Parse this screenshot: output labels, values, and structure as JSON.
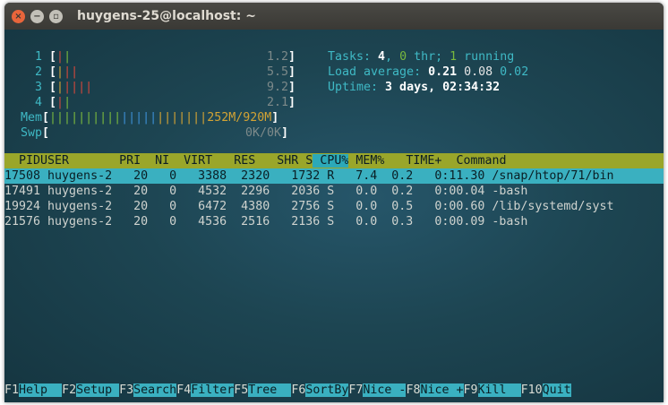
{
  "window": {
    "title": "huygens-25@localhost: ~"
  },
  "meters": {
    "cpus": [
      {
        "label": "1",
        "bars": [
          [
            "red",
            "|"
          ],
          [
            "green",
            "|"
          ]
        ],
        "value": "1.2"
      },
      {
        "label": "2",
        "bars": [
          [
            "yellow",
            "|"
          ],
          [
            "red",
            "|"
          ],
          [
            "red",
            "|"
          ]
        ],
        "value": "5.5"
      },
      {
        "label": "3",
        "bars": [
          [
            "yellow",
            "|"
          ],
          [
            "red",
            "|"
          ],
          [
            "red",
            "|"
          ],
          [
            "red",
            "|"
          ],
          [
            "red",
            "|"
          ]
        ],
        "value": "9.2"
      },
      {
        "label": "4",
        "bars": [
          [
            "red",
            "|"
          ],
          [
            "green",
            "|"
          ]
        ],
        "value": "2.1"
      }
    ],
    "mem": {
      "label": "Mem",
      "value": "252M/920M"
    },
    "swp": {
      "label": "Swp",
      "value": "0K/0K"
    }
  },
  "summary": {
    "tasks_label": "Tasks: ",
    "tasks": "4",
    "thr": "0",
    "thr_label": " thr; ",
    "running": "1",
    "running_label": " running",
    "load_label": "Load average: ",
    "load1": "0.21",
    "load5": "0.08",
    "load15": "0.02",
    "uptime_label": "Uptime: ",
    "uptime": "3 days, 02:34:32"
  },
  "columns": [
    "  PID",
    "USER      ",
    " PRI",
    "  NI",
    "  VIRT",
    "   RES",
    "   SHR",
    " S",
    " CPU%",
    " MEM%",
    "   TIME+ ",
    " Command"
  ],
  "processes": [
    {
      "pid": "17508",
      "user": "huygens-2",
      "pri": "20",
      "ni": "0",
      "virt": "3388",
      "res": "2320",
      "shr": "1732",
      "s": "R",
      "cpu": "7.4",
      "mem": "0.2",
      "time": "0:11.30",
      "cmd": "/snap/htop/71/bin"
    },
    {
      "pid": "17491",
      "user": "huygens-2",
      "pri": "20",
      "ni": "0",
      "virt": "4532",
      "res": "2296",
      "shr": "2036",
      "s": "S",
      "cpu": "0.0",
      "mem": "0.2",
      "time": "0:00.04",
      "cmd": "-bash"
    },
    {
      "pid": "19924",
      "user": "huygens-2",
      "pri": "20",
      "ni": "0",
      "virt": "6472",
      "res": "4380",
      "shr": "2756",
      "s": "S",
      "cpu": "0.0",
      "mem": "0.5",
      "time": "0:00.60",
      "cmd": "/lib/systemd/syst"
    },
    {
      "pid": "21576",
      "user": "huygens-2",
      "pri": "20",
      "ni": "0",
      "virt": "4536",
      "res": "2516",
      "shr": "2136",
      "s": "S",
      "cpu": "0.0",
      "mem": "0.3",
      "time": "0:00.09",
      "cmd": "-bash"
    }
  ],
  "function_keys": [
    {
      "key": "F1",
      "label": "Help  "
    },
    {
      "key": "F2",
      "label": "Setup "
    },
    {
      "key": "F3",
      "label": "Search"
    },
    {
      "key": "F4",
      "label": "Filter"
    },
    {
      "key": "F5",
      "label": "Tree  "
    },
    {
      "key": "F6",
      "label": "SortBy"
    },
    {
      "key": "F7",
      "label": "Nice -"
    },
    {
      "key": "F8",
      "label": "Nice +"
    },
    {
      "key": "F9",
      "label": "Kill  "
    },
    {
      "key": "F10",
      "label": "Quit"
    }
  ]
}
